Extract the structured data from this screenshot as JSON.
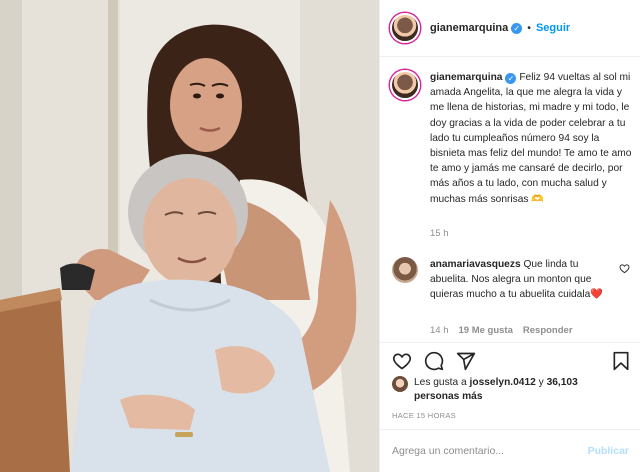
{
  "post": {
    "username": "gianemarquina",
    "follow_label": "Seguir",
    "separator": "•",
    "verified_icon": "verified-badge-icon",
    "caption_username": "gianemarquina",
    "caption_text": "Feliz 94 vueltas al sol mi amada Angelita, la que me alegra la vida y me llena de historias, mi madre y mi todo, le doy gracias a la vida de poder celebrar a tu lado tu cumpleaños número 94 soy la bisnieta mas feliz del mundo! Te amo te amo te amo y jamás me cansaré de decirlo, por más años a tu lado, con mucha salud y muchas más sonrisas 🫶",
    "caption_time": "15 h"
  },
  "comment": {
    "username": "anamariavasquezs",
    "text": "Que linda tu abuelita. Nos alegra un monton que quieras mucho a tu abuelita cuidala",
    "emoji": "❤️",
    "time": "14 h",
    "likes": "19 Me gusta",
    "reply_label": "Responder"
  },
  "likes": {
    "prefix": "Les gusta a",
    "user": "josselyn.0412",
    "conj": "y",
    "count": "36,103 personas más"
  },
  "posted_ago": "HACE 15 HORAS",
  "add_comment": {
    "placeholder": "Agrega un comentario...",
    "post_label": "Publicar"
  },
  "colors": {
    "accent": "#0095f6",
    "verified": "#3897f0",
    "muted": "#8e8e8e",
    "text": "#262626",
    "heart": "#ed4956"
  }
}
